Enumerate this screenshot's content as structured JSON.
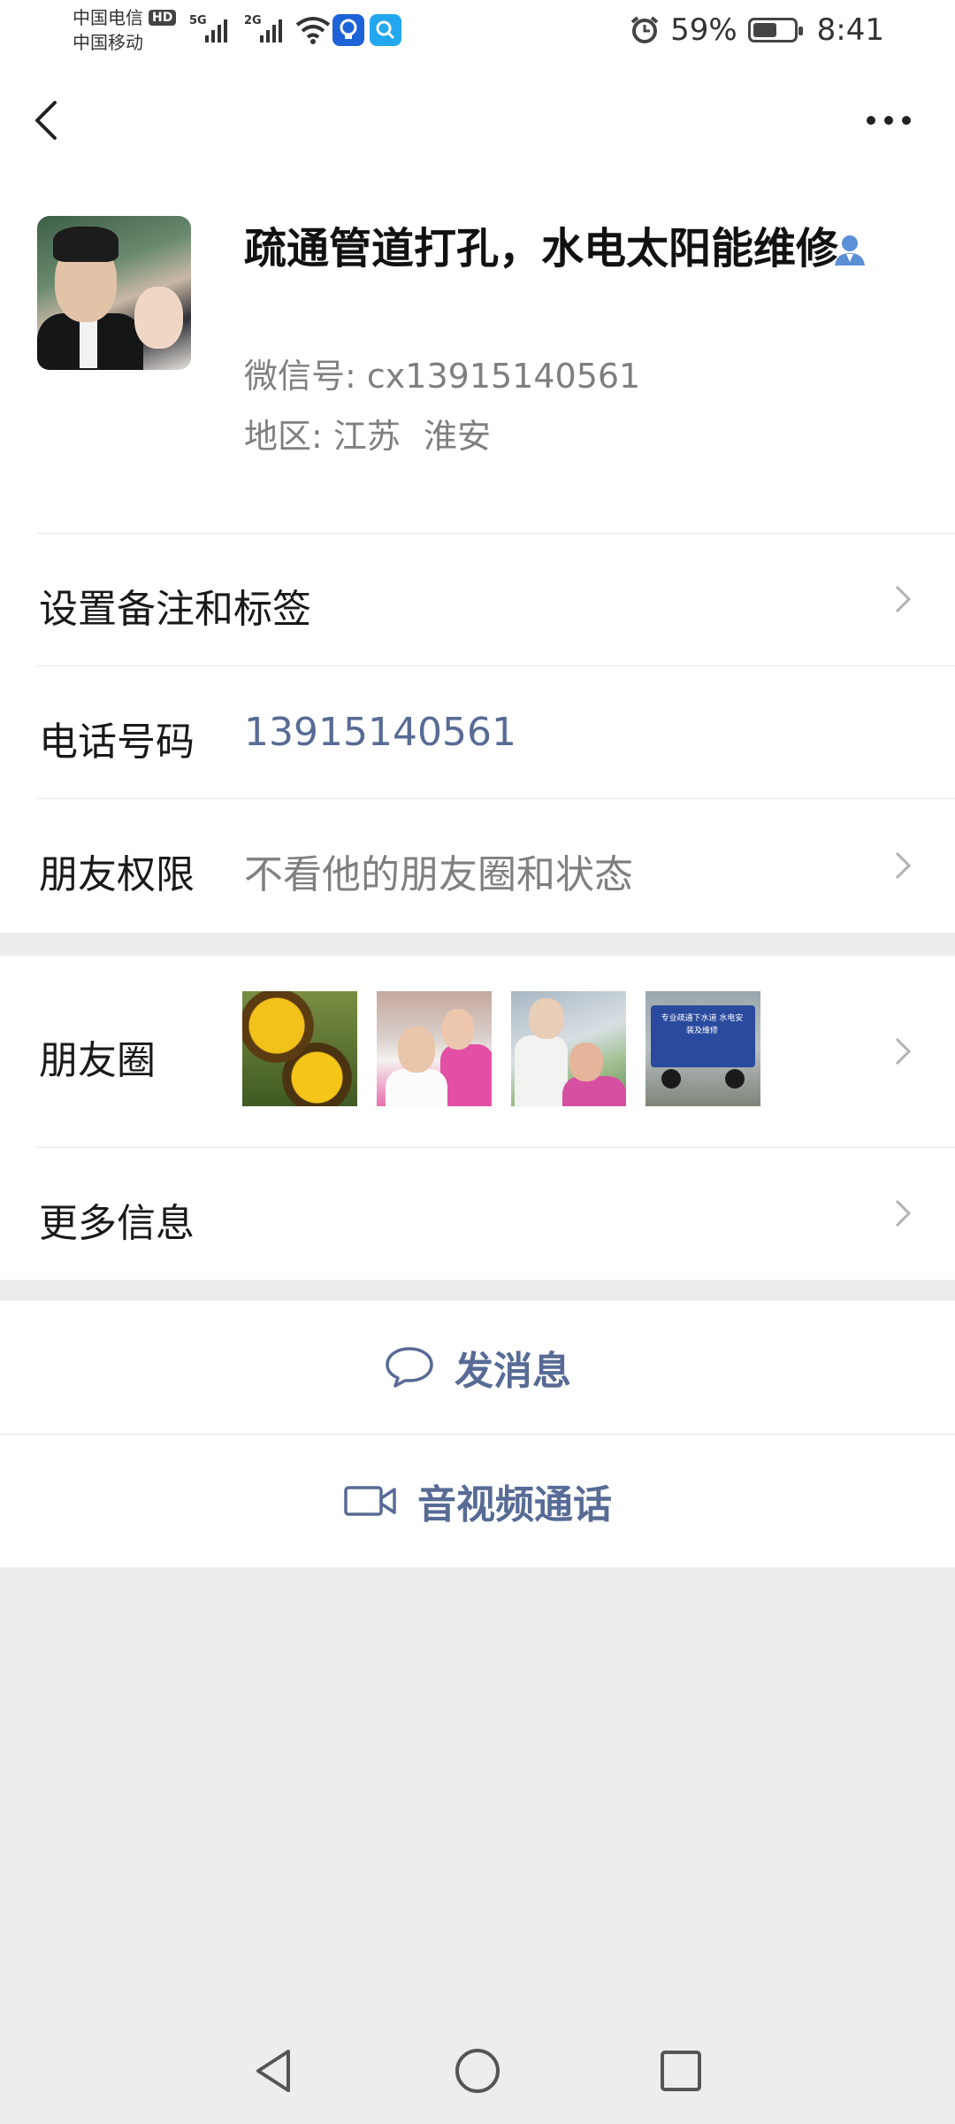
{
  "status_bar": {
    "carrier_1": "中国电信",
    "carrier_1_badge": "HD",
    "carrier_2": "中国移动",
    "network_1": "5G",
    "network_2": "2G",
    "battery_percent": "59%",
    "battery_level": 0.59,
    "time": "8:41",
    "icons": [
      "signal-icon",
      "wifi-icon",
      "lightbulb-app-icon",
      "search-app-icon",
      "alarm-icon",
      "battery-icon"
    ]
  },
  "navbar": {
    "back_icon": "chevron-left-icon",
    "more_icon": "more-dots-icon"
  },
  "profile": {
    "nickname": "疏通管道打孔，水电太阳能维修",
    "wechat_id_label": "微信号:",
    "wechat_id": "cx13915140561",
    "region_label": "地区:",
    "region_province": "江苏",
    "region_city": "淮安"
  },
  "rows": {
    "remark_label": "设置备注和标签",
    "phone_label": "电话号码",
    "phone_value": "13915140561",
    "permission_label": "朋友权限",
    "permission_value": "不看他的朋友圈和状态",
    "moments_label": "朋友圈",
    "more_info_label": "更多信息"
  },
  "moments": {
    "thumb_4_text": "专业疏通下水道 水电安装及维修"
  },
  "actions": {
    "message_label": "发消息",
    "call_label": "音视频通话"
  },
  "colors": {
    "link_blue": "#576b95",
    "background": "#ededed",
    "verify_blue": "#5b8fd6"
  }
}
